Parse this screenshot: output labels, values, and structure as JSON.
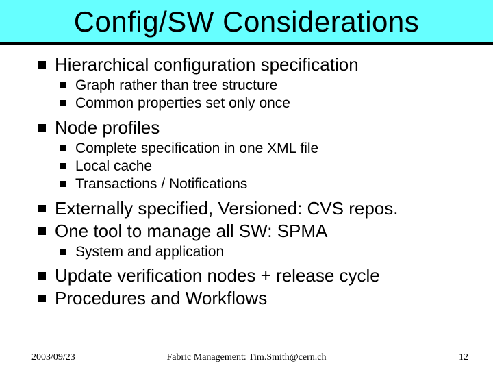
{
  "title": "Config/SW Considerations",
  "bullets": {
    "b0": {
      "text": "Hierarchical configuration specification",
      "subs": {
        "s0": "Graph rather than tree structure",
        "s1": "Common properties set only once"
      }
    },
    "b1": {
      "text": "Node profiles",
      "subs": {
        "s0": "Complete specification in one XML file",
        "s1": "Local cache",
        "s2": "Transactions / Notifications"
      }
    },
    "b2": {
      "text": "Externally specified, Versioned: CVS repos."
    },
    "b3": {
      "text": "One tool to manage all SW: SPMA",
      "subs": {
        "s0": "System and application"
      }
    },
    "b4": {
      "text": "Update verification nodes + release cycle"
    },
    "b5": {
      "text": "Procedures and Workflows"
    }
  },
  "footer": {
    "date": "2003/09/23",
    "center": "Fabric Management: Tim.Smith@cern.ch",
    "page": "12"
  }
}
